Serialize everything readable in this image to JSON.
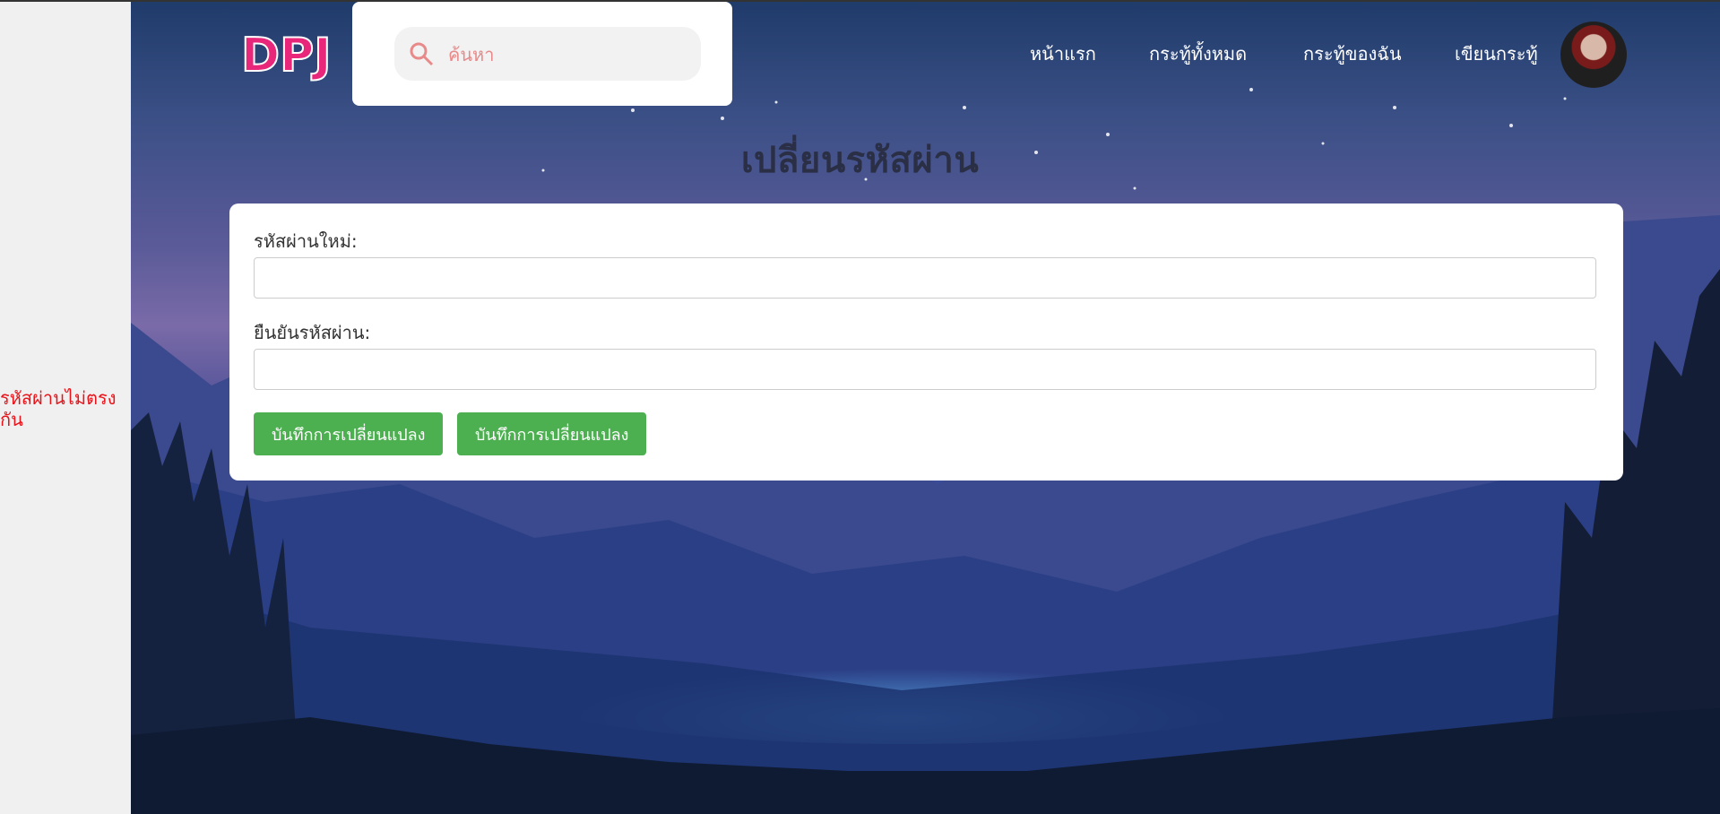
{
  "error": {
    "message": "รหัสผ่านไม่ตรงกัน"
  },
  "search": {
    "placeholder": "ค้นหา"
  },
  "nav": {
    "home": "หน้าแรก",
    "all_posts": "กระทู้ทั้งหมด",
    "my_posts": "กระทู้ของฉัน",
    "write_post": "เขียนกระทู้"
  },
  "logo": {
    "text": "DPJ"
  },
  "page": {
    "title": "เปลี่ยนรหัสผ่าน"
  },
  "form": {
    "new_password_label": "รหัสผ่านใหม่:",
    "confirm_password_label": "ยืนยันรหัสผ่าน:",
    "save_button_1": "บันทึกการเปลี่ยนแปลง",
    "save_button_2": "บันทึกการเปลี่ยนแปลง"
  },
  "colors": {
    "button": "#4caf50",
    "error": "#e8141b",
    "logo": "#e8267a"
  }
}
